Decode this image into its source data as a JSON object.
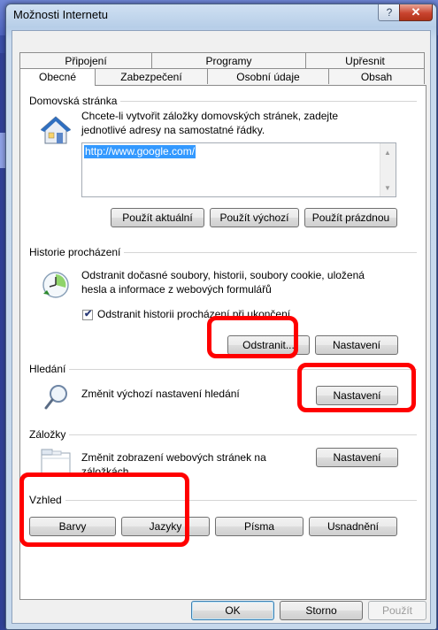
{
  "window": {
    "title": "Možnosti Internetu",
    "help": "?",
    "close": "✕"
  },
  "tabs": {
    "row1": [
      "Připojení",
      "Programy",
      "Upřesnit"
    ],
    "row2": [
      "Obecné",
      "Zabezpečení",
      "Osobní údaje",
      "Obsah"
    ],
    "active": "Obecné"
  },
  "home": {
    "group_label": "Domovská stránka",
    "description_line1": "Chcete-li vytvořit záložky domovských stránek, zadejte",
    "description_line2": "jednotlivé adresy na samostatné řádky.",
    "url": "http://www.google.com/",
    "buttons": {
      "current": "Použít aktuální",
      "default": "Použít výchozí",
      "blank": "Použít prázdnou"
    }
  },
  "history": {
    "group_label": "Historie procházení",
    "description_line1": "Odstranit dočasné soubory, historii, soubory cookie, uložená",
    "description_line2": "hesla a informace z webových formulářů",
    "checkbox_label": "Odstranit historii procházení při ukončení",
    "checkbox_checked": true,
    "delete_button": "Odstranit...",
    "settings_button": "Nastavení"
  },
  "search": {
    "group_label": "Hledání",
    "description": "Změnit výchozí nastavení hledání",
    "settings_button": "Nastavení"
  },
  "tabs_group": {
    "group_label": "Záložky",
    "description_line1": "Změnit zobrazení webových stránek na",
    "description_line2": "záložkách",
    "settings_button": "Nastavení"
  },
  "appearance": {
    "group_label": "Vzhled",
    "buttons": {
      "colors": "Barvy",
      "languages": "Jazyky",
      "fonts": "Písma",
      "accessibility": "Usnadnění"
    }
  },
  "footer": {
    "ok": "OK",
    "cancel": "Storno",
    "apply": "Použít"
  },
  "highlight_color": "#ff0000"
}
